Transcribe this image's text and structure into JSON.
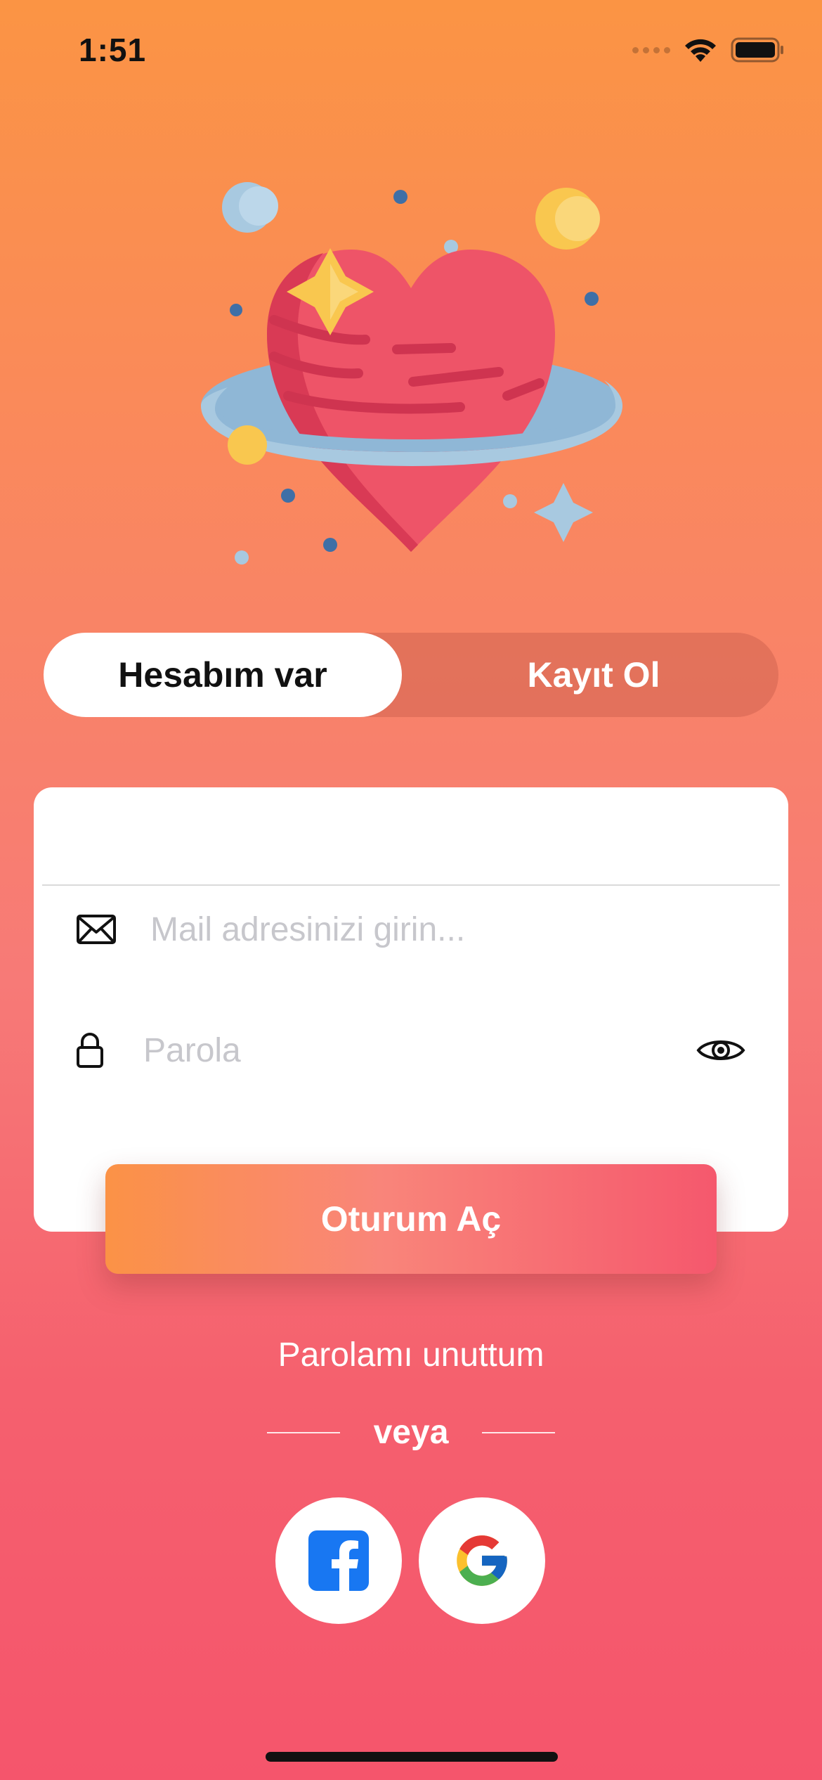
{
  "status_bar": {
    "time": "1:51"
  },
  "auth_toggle": {
    "active_label": "Hesabım var",
    "inactive_label": "Kayıt Ol"
  },
  "form": {
    "email_placeholder": "Mail adresinizi girin...",
    "email_value": "",
    "password_placeholder": "Parola",
    "password_value": ""
  },
  "login_button": "Oturum Aç",
  "forgot_password": "Parolamı unuttum",
  "or_divider": "veya",
  "social": {
    "facebook_icon": "facebook-icon",
    "google_icon": "google-icon"
  },
  "colors": {
    "gradient_top": "#fb9444",
    "gradient_bottom": "#f5556c",
    "button_start": "#fb9246",
    "button_end": "#f5586d",
    "facebook_blue": "#1877f2"
  }
}
